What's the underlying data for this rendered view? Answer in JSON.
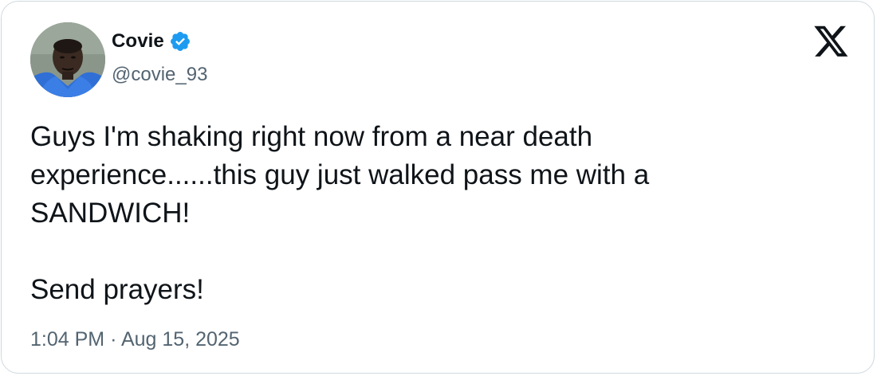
{
  "author": {
    "display_name": "Covie",
    "handle": "@covie_93",
    "verified": true,
    "avatar_icon": "profile-photo"
  },
  "tweet": {
    "text": "Guys I'm shaking right now from a near death\nexperience......this guy just walked pass me with a\nSANDWICH!\n\nSend prayers!",
    "time": "1:04 PM",
    "separator": "·",
    "date": "Aug 15, 2025"
  },
  "brand": {
    "logo_icon": "x-logo-icon"
  },
  "colors": {
    "text_primary": "#0f1419",
    "text_secondary": "#536471",
    "verified_badge": "#1d9bf0",
    "border": "#cfd9de"
  }
}
